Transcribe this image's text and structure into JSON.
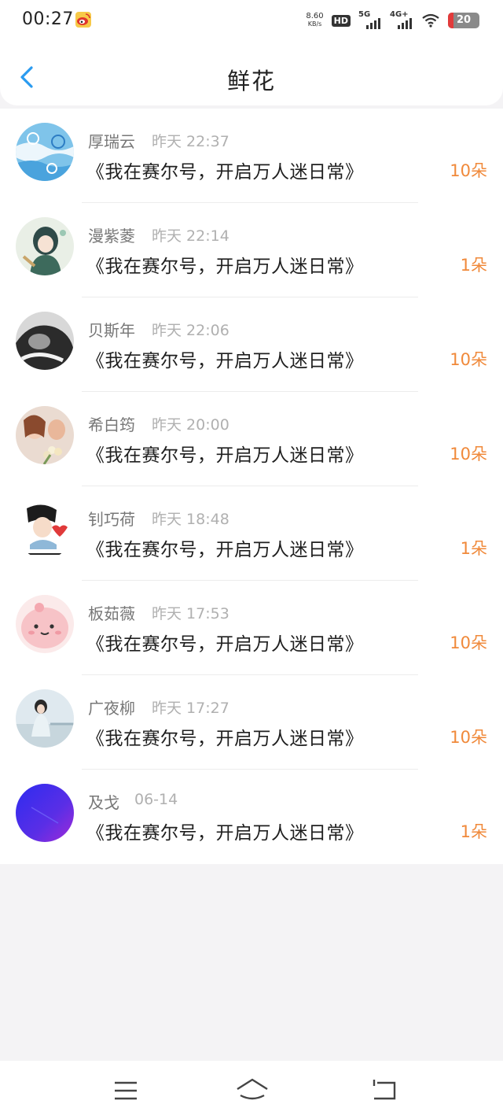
{
  "status_bar": {
    "time": "00:27",
    "net_speed_value": "8.60",
    "net_speed_unit": "KB/s",
    "hd_label": "HD",
    "sim1_label": "5G",
    "sim2_label": "4G+",
    "battery_level": "20"
  },
  "header": {
    "title": "鲜花"
  },
  "list": [
    {
      "name": "厚瑞云",
      "time": "昨天 22:37",
      "title": "《我在赛尔号，开启万人迷日常》",
      "count": "10朵"
    },
    {
      "name": "漫紫菱",
      "time": "昨天 22:14",
      "title": "《我在赛尔号，开启万人迷日常》",
      "count": "1朵"
    },
    {
      "name": "贝斯年",
      "time": "昨天 22:06",
      "title": "《我在赛尔号，开启万人迷日常》",
      "count": "10朵"
    },
    {
      "name": "希白筠",
      "time": "昨天 20:00",
      "title": "《我在赛尔号，开启万人迷日常》",
      "count": "10朵"
    },
    {
      "name": "钊巧荷",
      "time": "昨天 18:48",
      "title": "《我在赛尔号，开启万人迷日常》",
      "count": "1朵"
    },
    {
      "name": "板茹薇",
      "time": "昨天 17:53",
      "title": "《我在赛尔号，开启万人迷日常》",
      "count": "10朵"
    },
    {
      "name": "广夜柳",
      "time": "昨天 17:27",
      "title": "《我在赛尔号，开启万人迷日常》",
      "count": "10朵"
    },
    {
      "name": "及戈",
      "time": "06-14",
      "title": "《我在赛尔号，开启万人迷日常》",
      "count": "1朵"
    }
  ],
  "colors": {
    "accent": "#2a9bf0",
    "count": "#f0893a",
    "background": "#f4f3f5"
  },
  "icons": {
    "back": "chevron-left-icon",
    "nav_menu": "menu-icon",
    "nav_home": "home-icon",
    "nav_back": "back-icon"
  }
}
